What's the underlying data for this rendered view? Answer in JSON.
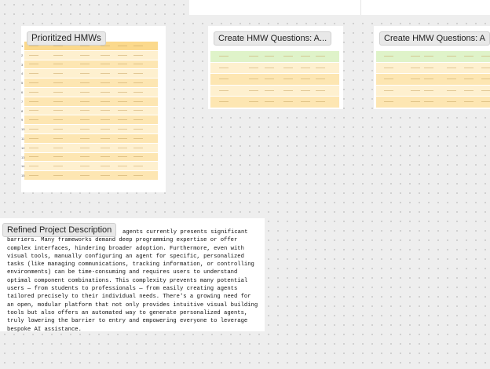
{
  "canvas": {
    "background": "#eeeeee",
    "dot_color": "#c9c9c9"
  },
  "frames": {
    "prioritized": {
      "title": "Prioritized HMWs",
      "row_numbers": [
        "1",
        "2",
        "3",
        "4",
        "5",
        "6",
        "7",
        "8",
        "9",
        "10",
        "11",
        "12",
        "13",
        "14",
        "15"
      ]
    },
    "create_hmw_1": {
      "title": "Create HMW Questions: A..."
    },
    "create_hmw_2": {
      "title": "Create HMW Questions: A"
    },
    "refined": {
      "title": "Refined Project Description",
      "text": "agents currently presents significant barriers. Many frameworks demand deep programming expertise or offer complex interfaces, hindering broader adoption. Furthermore, even with visual tools, manually configuring an agent for specific, personalized tasks (like managing communications, tracking information, or controlling environments) can be time-consuming and requires users to understand optimal component combinations. This complexity prevents many potential users — from students to professionals — from easily creating agents tailored precisely to their individual needs. There's a growing need for an open, modular platform that not only provides intuitive visual building tools but also offers an automated way to generate personalized agents, truly lowering the barrier to entry and empowering everyone to leverage bespoke AI assistance."
    }
  },
  "colors": {
    "sheet_header": "#fbd98c",
    "sheet_row": "#fde6b2",
    "sheet_row_alt": "#fef0cf",
    "sheet_green": "#dff3c9"
  }
}
